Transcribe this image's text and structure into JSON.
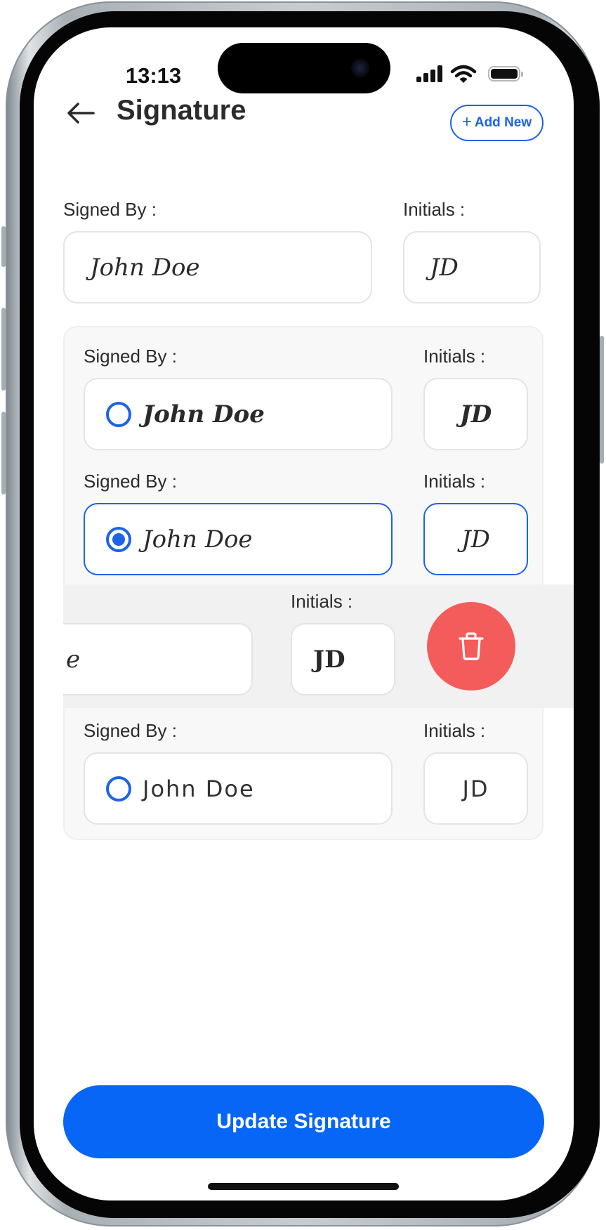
{
  "status_bar": {
    "time": "13:13"
  },
  "header": {
    "title": "Signature",
    "add_new_label": "Add New",
    "add_new_plus": "+",
    "back_arrow_icon": "back-arrow-icon"
  },
  "primary": {
    "signed_by_label": "Signed By :",
    "initials_label": "Initials :",
    "signature": "John Doe",
    "initials": "JD"
  },
  "options": [
    {
      "signed_by_label": "Signed By :",
      "initials_label": "Initials :",
      "signature": "John Doe",
      "initials": "JD",
      "selected": false
    },
    {
      "signed_by_label": "Signed By :",
      "initials_label": "Initials :",
      "signature": "John Doe",
      "initials": "JD",
      "selected": true
    },
    {
      "initials_label": "Initials :",
      "signature_tail": "e",
      "initials": "JD",
      "swiped": true
    },
    {
      "signed_by_label": "Signed By :",
      "initials_label": "Initials :",
      "signature": "John Doe",
      "initials": "JD",
      "selected": false
    }
  ],
  "delete_icon": "trash-icon",
  "update_button_label": "Update Signature",
  "colors": {
    "accent": "#1d63e8",
    "primary_button": "#0766f5",
    "delete": "#f45b5b",
    "panel_bg": "#f8f8f8"
  }
}
